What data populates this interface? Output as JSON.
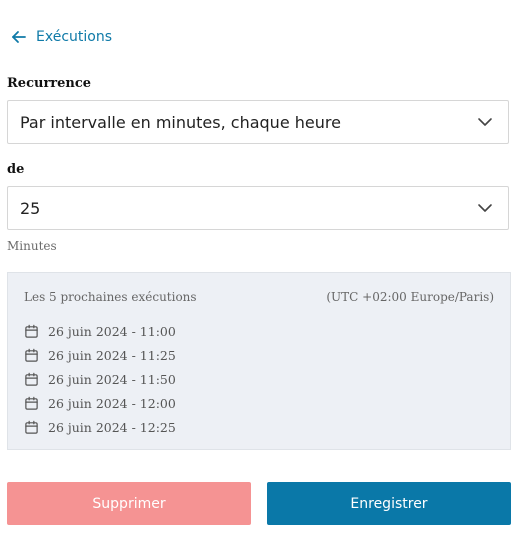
{
  "nav": {
    "back_label": "Exécutions"
  },
  "recurrence": {
    "label": "Recurrence",
    "value": "Par intervalle en minutes, chaque heure"
  },
  "start": {
    "label": "de",
    "value": "25",
    "hint": "Minutes"
  },
  "upcoming": {
    "title": "Les 5 prochaines exécutions",
    "timezone": "(UTC +02:00 Europe/Paris)",
    "runs": [
      "26 juin 2024 - 11:00",
      "26 juin 2024 - 11:25",
      "26 juin 2024 - 11:50",
      "26 juin 2024 - 12:00",
      "26 juin 2024 - 12:25"
    ]
  },
  "actions": {
    "delete_label": "Supprimer",
    "save_label": "Enregistrer"
  },
  "icons": {
    "back": "arrow-left-icon",
    "dropdown": "chevron-down-icon",
    "run": "calendar-icon"
  },
  "colors": {
    "accent": "#0f7aa8",
    "save": "#0a78a8",
    "delete": "#f59393",
    "panel": "#edf0f5"
  }
}
